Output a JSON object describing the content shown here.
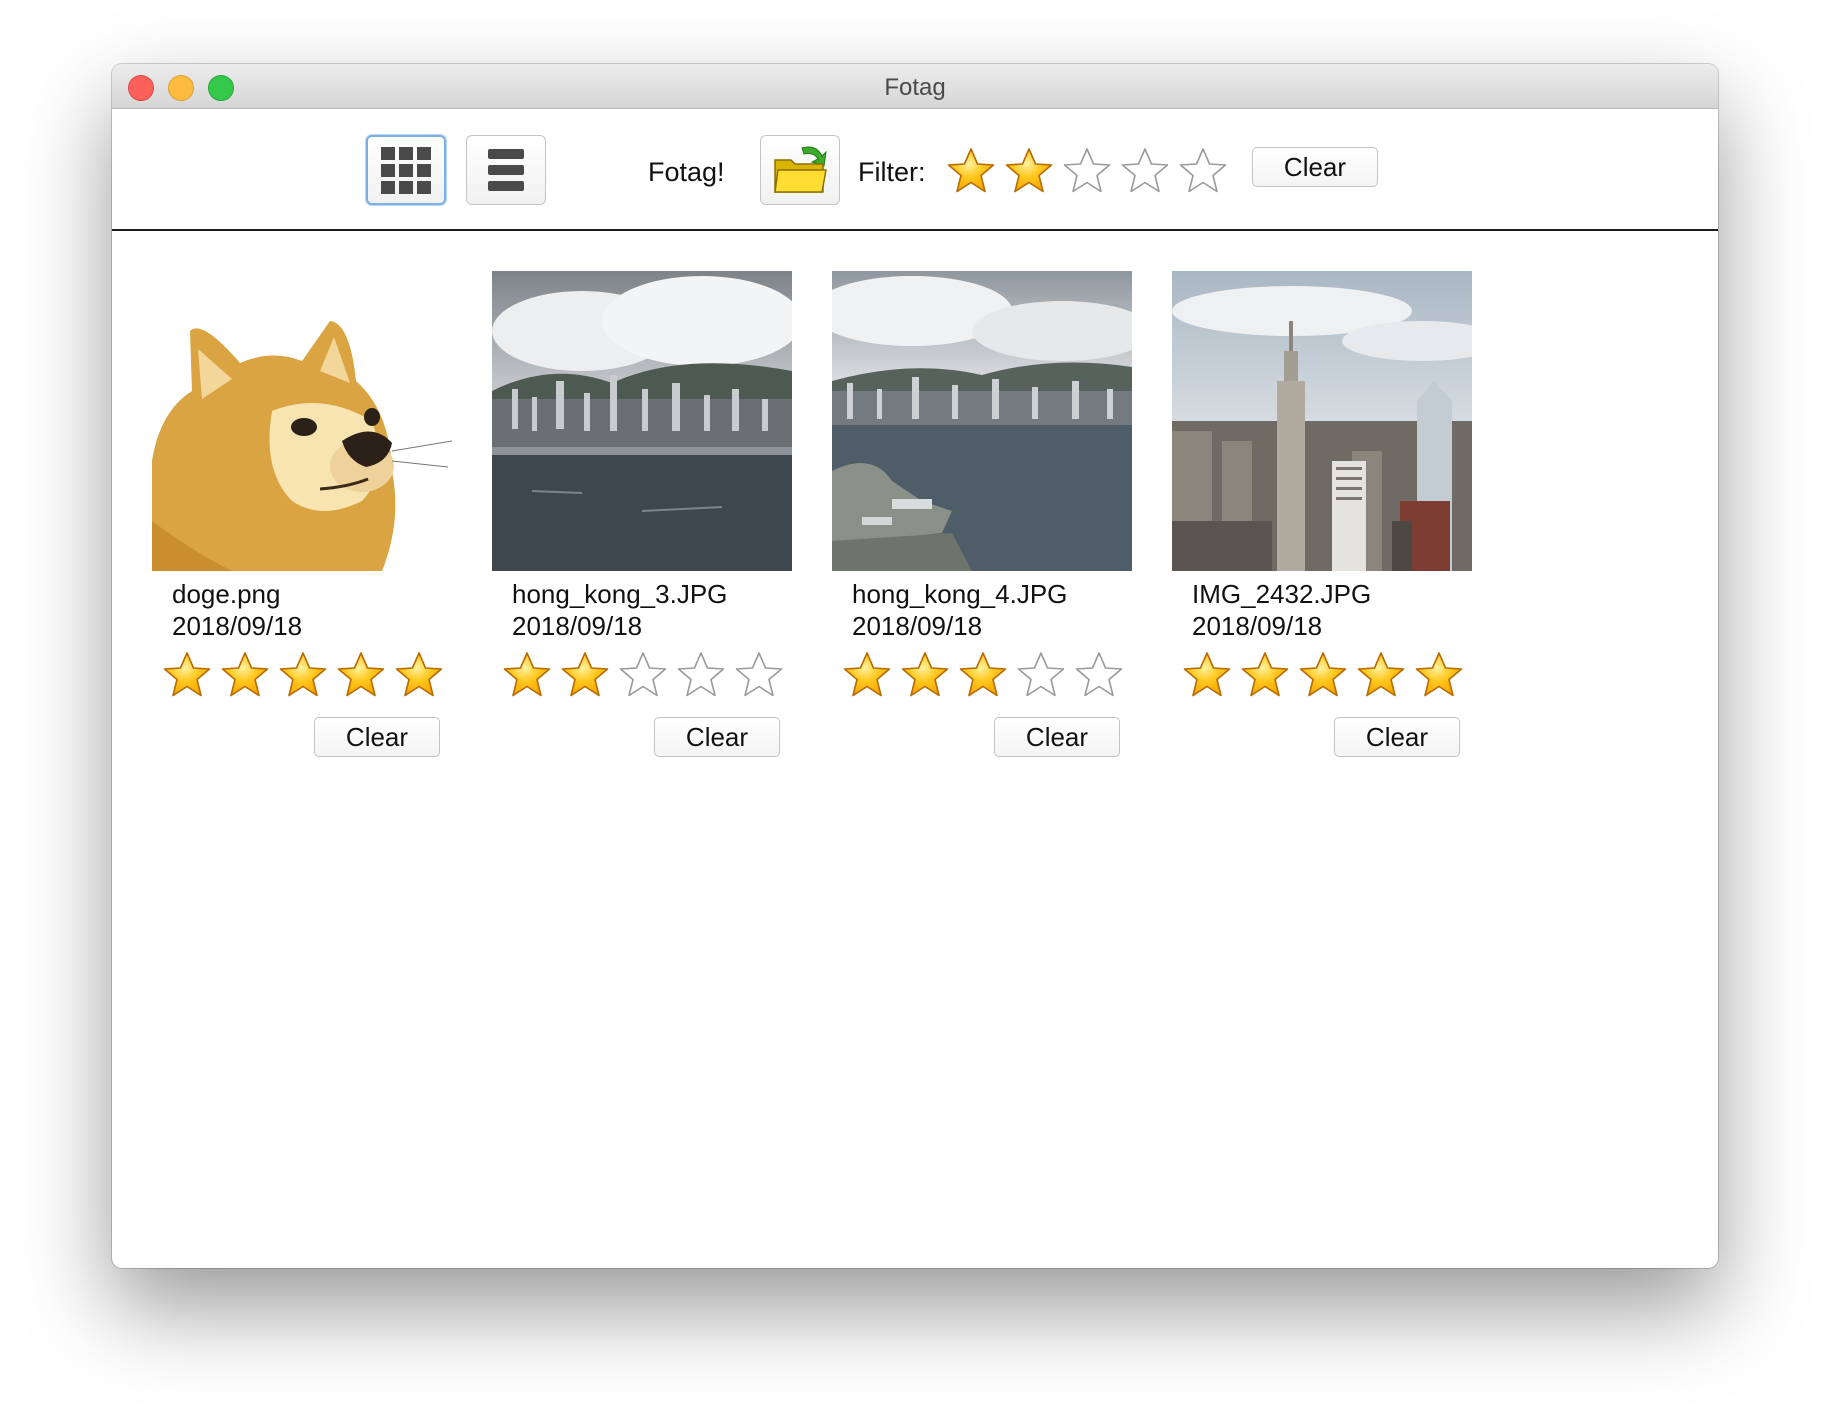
{
  "window": {
    "title": "Fotag"
  },
  "toolbar": {
    "app_label": "Fotag!",
    "filter_label": "Filter:",
    "filter_rating": 2,
    "max_rating": 5,
    "clear_label": "Clear",
    "grid_view_icon": "grid-view-icon",
    "list_view_icon": "list-view-icon",
    "open_icon": "open-folder-icon",
    "active_view": "grid"
  },
  "photos": [
    {
      "name": "doge.png",
      "date": "2018/09/18",
      "rating": 5,
      "clear_label": "Clear"
    },
    {
      "name": "hong_kong_3.JPG",
      "date": "2018/09/18",
      "rating": 2,
      "clear_label": "Clear"
    },
    {
      "name": "hong_kong_4.JPG",
      "date": "2018/09/18",
      "rating": 3,
      "clear_label": "Clear"
    },
    {
      "name": "IMG_2432.JPG",
      "date": "2018/09/18",
      "rating": 5,
      "clear_label": "Clear"
    }
  ],
  "colors": {
    "star_filled": "#f5a300",
    "star_empty": "#ffffff",
    "selected_border": "#7db0e3"
  }
}
